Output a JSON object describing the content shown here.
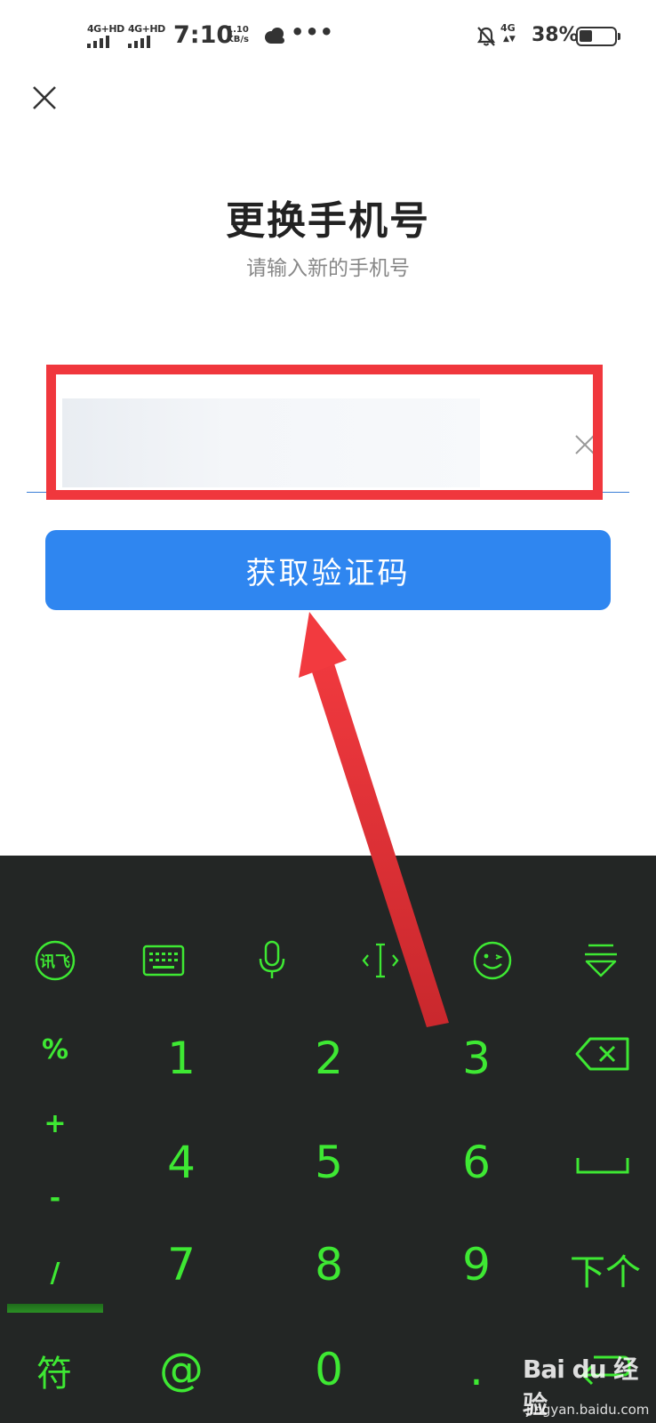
{
  "status_bar": {
    "sim1": "4G+HD",
    "sim2": "4G+HD",
    "time": "7:10",
    "speed_value": "1.10",
    "speed_unit": "KB/s",
    "more": "•••",
    "network": "4G",
    "battery_percent": "38%",
    "battery_level": 0.38
  },
  "header": {
    "title": "更换手机号",
    "subtitle": "请输入新的手机号"
  },
  "phone_input": {
    "value": ""
  },
  "submit_label": "获取验证码",
  "keyboard": {
    "toolbar_icons": [
      "iflytek-logo-icon",
      "keyboard-icon",
      "microphone-icon",
      "cursor-icon",
      "emoji-icon",
      "collapse-keyboard-icon"
    ],
    "symbols": [
      "%",
      "+",
      "-",
      "/"
    ],
    "digits": [
      "1",
      "2",
      "3",
      "4",
      "5",
      "6",
      "7",
      "8",
      "9",
      "0"
    ],
    "symbol_switch": "符",
    "at": "@",
    "dot": ".",
    "next": "下个",
    "accent_color": "#3ee833",
    "background_color": "#232625"
  },
  "watermark": {
    "logo": "Bai du 经验",
    "url": "jingyan.baidu.com"
  },
  "colors": {
    "primary_button": "#2f86f0",
    "highlight": "#f0373d"
  }
}
